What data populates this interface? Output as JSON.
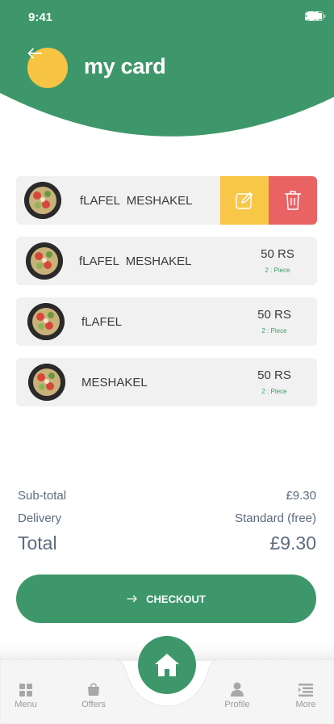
{
  "status_bar": {
    "time": "9:41"
  },
  "header": {
    "title": "my card",
    "accent_color": "#3e976a",
    "back_icon": "arrow-left-icon"
  },
  "cart": {
    "items": [
      {
        "name": "fLAFEL  MESHAKEL",
        "price": "",
        "qty": ""
      },
      {
        "name": "fLAFEL  MESHAKEL",
        "price": "50 RS",
        "qty": "2 : Piece"
      },
      {
        "name": "fLAFEL",
        "price": "50 RS",
        "qty": "2 : Piece"
      },
      {
        "name": "MESHAKEL",
        "price": "50 RS",
        "qty": "2 : Piece"
      }
    ],
    "swipe_actions": {
      "edit_icon": "edit-icon",
      "delete_icon": "trash-icon",
      "edit_color": "#f8c747",
      "delete_color": "#e96365"
    }
  },
  "summary": {
    "subtotal_label": "Sub-total",
    "subtotal_value": "£9.30",
    "delivery_label": "Delivery",
    "delivery_value": "Standard (free)",
    "total_label": "Total",
    "total_value": "£9.30"
  },
  "checkout": {
    "label": "CHECKOUT",
    "icon": "arrow-right-icon"
  },
  "tabbar": {
    "menu_label": "Menu",
    "offers_label": "Offers",
    "profile_label": "Profile",
    "more_label": "More",
    "home_icon": "home-icon"
  }
}
